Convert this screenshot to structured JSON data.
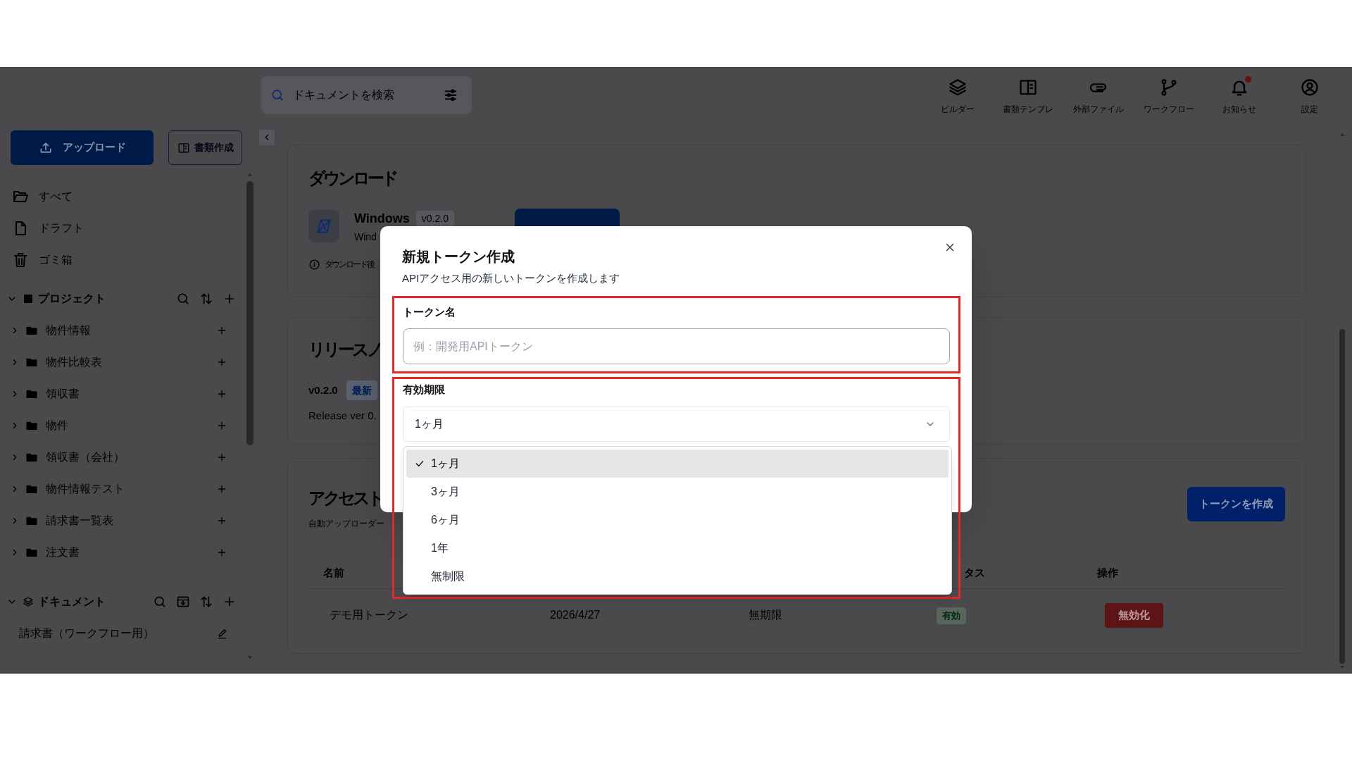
{
  "header": {
    "search": {
      "placeholder": "ドキュメントを検索"
    },
    "nav": [
      {
        "label": "ビルダー",
        "unread": false
      },
      {
        "label": "書類テンプレ",
        "unread": false
      },
      {
        "label": "外部ファイル",
        "unread": false
      },
      {
        "label": "ワークフロー",
        "unread": false
      },
      {
        "label": "お知らせ",
        "unread": true
      },
      {
        "label": "設定",
        "unread": false
      }
    ]
  },
  "sidebar": {
    "upload_button": "アップロード",
    "create_button": "書類作成",
    "links": [
      {
        "label": "すべて"
      },
      {
        "label": "ドラフト"
      },
      {
        "label": "ゴミ箱"
      }
    ],
    "projects": {
      "title": "プロジェクト",
      "expanded": true,
      "folders": [
        {
          "label": "物件情報",
          "expanded": false
        },
        {
          "label": "物件比較表",
          "expanded": false
        },
        {
          "label": "領収書",
          "expanded": false
        },
        {
          "label": "物件",
          "expanded": false
        },
        {
          "label": "領収書（会社）",
          "expanded": false
        },
        {
          "label": "物件情報テスト",
          "expanded": false
        },
        {
          "label": "請求書一覧表",
          "expanded": false
        },
        {
          "label": "注文書",
          "expanded": false
        }
      ]
    },
    "documents": {
      "title": "ドキュメント",
      "expanded": true,
      "items": [
        {
          "label": "請求書（ワークフロー用）"
        }
      ]
    }
  },
  "main": {
    "download": {
      "title": "ダウンロード",
      "platform": "Windows",
      "version": "v0.2.0",
      "description": "Wind",
      "note": "ダウンロード後"
    },
    "release_notes": {
      "title": "リリースノ",
      "version": "v0.2.0",
      "badge": "最新",
      "text": "Release ver 0."
    },
    "tokens": {
      "title": "アクセスト",
      "subtitle": "自動アップローダー",
      "create_button": "トークンを作成",
      "columns": [
        {
          "label": "名前"
        },
        {
          "label": "タス"
        },
        {
          "label": "操作"
        }
      ],
      "rows": [
        {
          "cells": [
            "デモ用トークン",
            "2026/4/27",
            "無期限"
          ],
          "status": "有効",
          "action": "無効化"
        }
      ]
    }
  },
  "dialog": {
    "title": "新規トークン作成",
    "description": "APIアクセス用の新しいトークンを作成します",
    "fields": [
      {
        "kind": "text",
        "label": "トークン名",
        "placeholder": "例：開発用APIトークン",
        "highlighted": true
      },
      {
        "kind": "select",
        "label": "有効期限",
        "value": "1ヶ月",
        "expanded": true,
        "highlighted": true,
        "options": [
          {
            "label": "1ヶ月",
            "selected": true
          },
          {
            "label": "3ヶ月",
            "selected": false
          },
          {
            "label": "6ヶ月",
            "selected": false
          },
          {
            "label": "1年",
            "selected": false
          },
          {
            "label": "無制限",
            "selected": false
          }
        ]
      }
    ]
  }
}
